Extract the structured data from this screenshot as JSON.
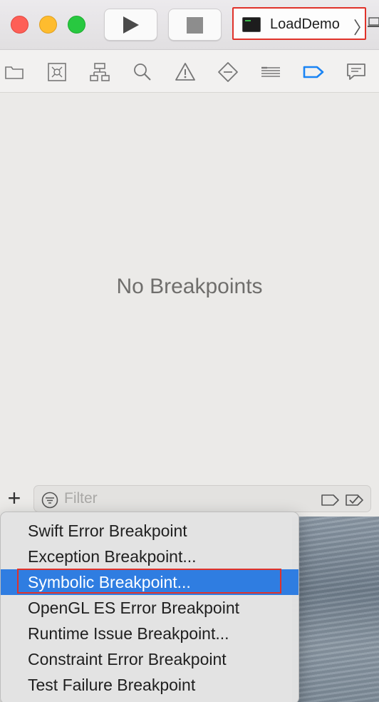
{
  "toolbar": {
    "run_icon": "play-icon",
    "stop_icon": "stop-icon",
    "scheme": {
      "icon": "terminal-app-icon",
      "name": "LoadDemo",
      "chevron": "〉"
    }
  },
  "navigator_tabs": [
    {
      "name": "project-navigator",
      "icon": "folder-icon"
    },
    {
      "name": "source-control-navigator",
      "icon": "source-control-icon"
    },
    {
      "name": "symbol-navigator",
      "icon": "hierarchy-icon"
    },
    {
      "name": "find-navigator",
      "icon": "magnifier-icon"
    },
    {
      "name": "issue-navigator",
      "icon": "warning-icon"
    },
    {
      "name": "test-navigator",
      "icon": "diamond-icon"
    },
    {
      "name": "debug-navigator",
      "icon": "list-icon"
    },
    {
      "name": "breakpoint-navigator",
      "icon": "breakpoint-icon",
      "active": true
    },
    {
      "name": "report-navigator",
      "icon": "speech-bubble-icon"
    }
  ],
  "content": {
    "empty_message": "No Breakpoints"
  },
  "filter_bar": {
    "add_label": "+",
    "filter_placeholder": "Filter"
  },
  "menu": {
    "items": [
      {
        "label": "Swift Error Breakpoint"
      },
      {
        "label": "Exception Breakpoint..."
      },
      {
        "label": "Symbolic Breakpoint...",
        "selected": true
      },
      {
        "label": "OpenGL ES Error Breakpoint"
      },
      {
        "label": "Runtime Issue Breakpoint..."
      },
      {
        "label": "Constraint Error Breakpoint"
      },
      {
        "label": "Test Failure Breakpoint"
      }
    ]
  },
  "colors": {
    "accent": "#2f7de1",
    "annotation_red": "#e0322a",
    "active_tab_blue": "#1a84f4"
  }
}
